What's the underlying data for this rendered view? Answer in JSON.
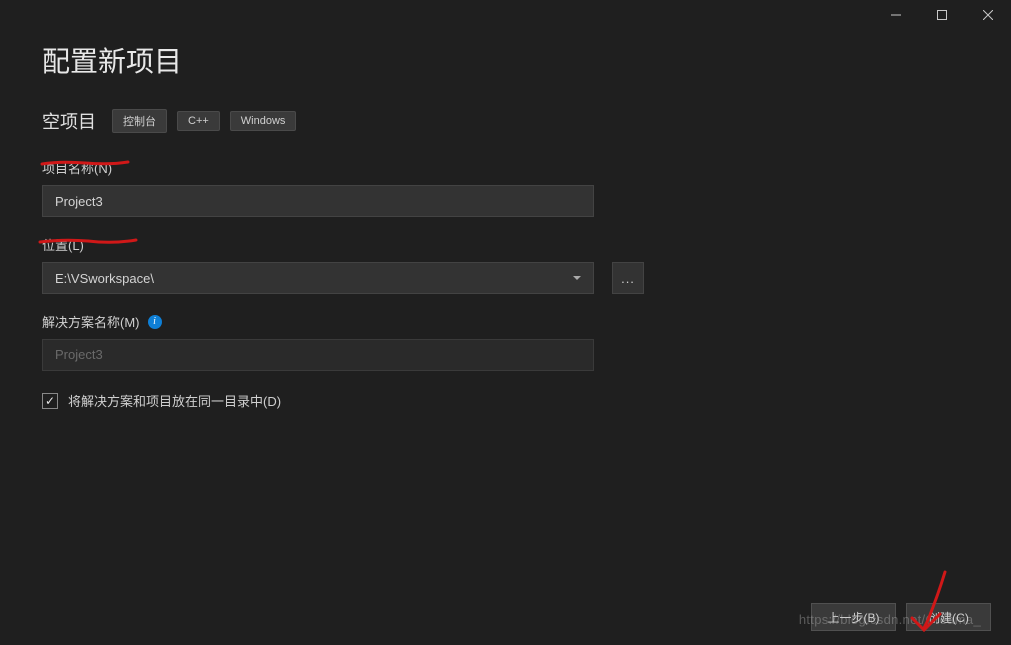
{
  "page": {
    "title": "配置新项目",
    "subtitle": "空项目"
  },
  "chips": {
    "console": "控制台",
    "cpp": "C++",
    "windows": "Windows"
  },
  "fields": {
    "projectName": {
      "label": "项目名称(N)",
      "value": "Project3"
    },
    "location": {
      "label": "位置(L)",
      "value": "E:\\VSworkspace\\",
      "browse": "..."
    },
    "solutionName": {
      "label": "解决方案名称(M)",
      "value": "Project3"
    },
    "sameDir": {
      "label": "将解决方案和项目放在同一目录中(D)"
    }
  },
  "footer": {
    "back": "上一步(B)",
    "create": "创建(C)"
  },
  "watermark": "https://blog.csdn.net/Creama_"
}
